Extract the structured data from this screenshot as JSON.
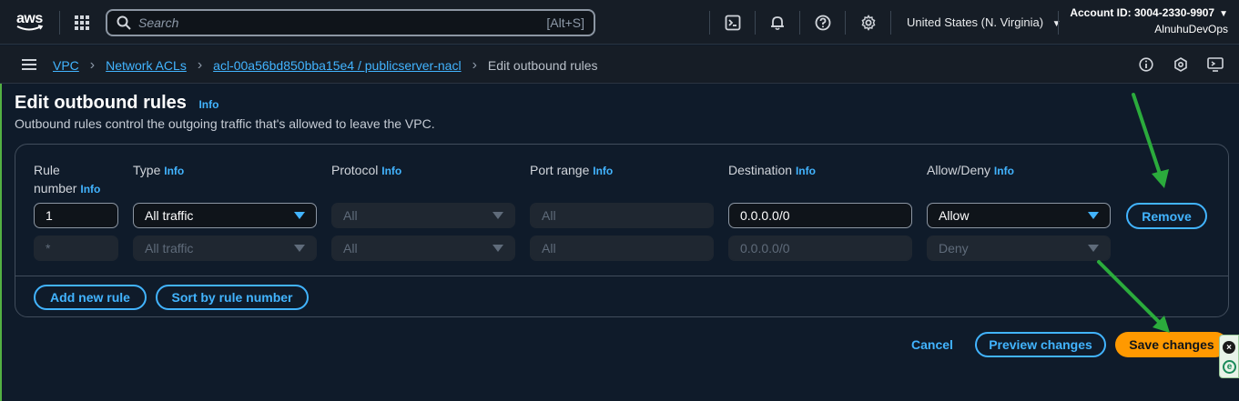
{
  "topnav": {
    "logo_text": "aws",
    "search_placeholder": "Search",
    "search_shortcut": "[Alt+S]",
    "region": "United States (N. Virginia)",
    "account_id": "Account ID: 3004-2330-9907",
    "account_user": "AlnuhuDevOps",
    "icons": [
      "grid-icon",
      "search-icon",
      "cloudshell-icon",
      "bell-icon",
      "help-icon",
      "gear-icon"
    ]
  },
  "breadcrumb": {
    "items": [
      "VPC",
      "Network ACLs",
      "acl-00a56bd850bba15e4 / publicserver-nacl"
    ],
    "current": "Edit outbound rules"
  },
  "page": {
    "title": "Edit outbound rules",
    "info": "Info",
    "subtitle": "Outbound rules control the outgoing traffic that's allowed to leave the VPC."
  },
  "table": {
    "headers": {
      "rule_number_1": "Rule",
      "rule_number_2": "number",
      "type": "Type",
      "protocol": "Protocol",
      "port_range": "Port range",
      "destination": "Destination",
      "allow_deny": "Allow/Deny",
      "info": "Info"
    },
    "rows": [
      {
        "rule_number": "1",
        "type": "All traffic",
        "protocol": "All",
        "port_range": "All",
        "destination": "0.0.0.0/0",
        "allow_deny": "Allow",
        "remove": "Remove"
      },
      {
        "rule_number": "*",
        "type": "All traffic",
        "protocol": "All",
        "port_range": "All",
        "destination": "0.0.0.0/0",
        "allow_deny": "Deny"
      }
    ],
    "add_rule": "Add new rule",
    "sort_rule": "Sort by rule number"
  },
  "footer": {
    "cancel": "Cancel",
    "preview": "Preview changes",
    "save": "Save changes"
  },
  "colors": {
    "accent": "#42b4ff",
    "primary": "#ff9900",
    "annotation": "#2bab3c"
  }
}
